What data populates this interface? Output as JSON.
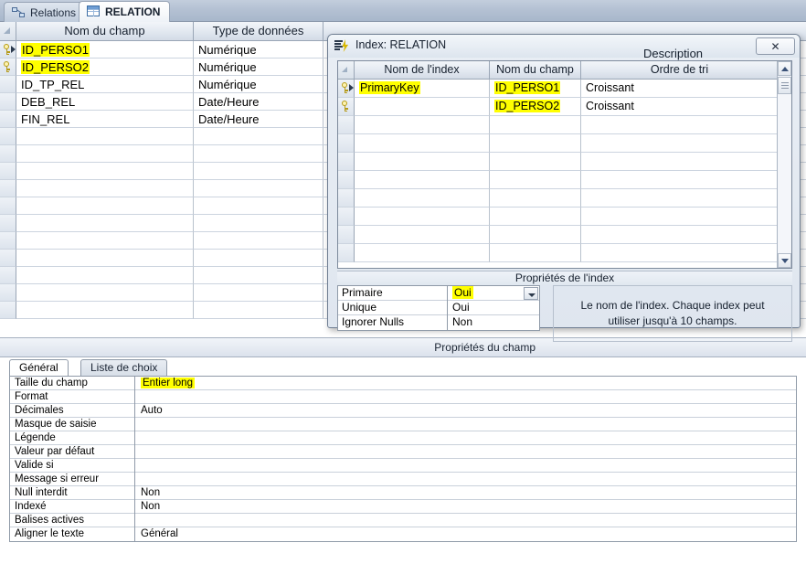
{
  "tabs": [
    {
      "label": "Relations",
      "icon": "relations-icon",
      "active": false
    },
    {
      "label": "RELATION",
      "icon": "table-icon",
      "active": true
    }
  ],
  "designer": {
    "columns": [
      "Nom du champ",
      "Type de données",
      "Description"
    ],
    "rows": [
      {
        "name": "ID_PERSO1",
        "type": "Numérique",
        "description": "",
        "key": true,
        "selected": true,
        "highlight": true
      },
      {
        "name": "ID_PERSO2",
        "type": "Numérique",
        "description": "",
        "key": true,
        "selected": false,
        "highlight": true
      },
      {
        "name": "ID_TP_REL",
        "type": "Numérique",
        "description": "",
        "key": false,
        "selected": false,
        "highlight": false
      },
      {
        "name": "DEB_REL",
        "type": "Date/Heure",
        "description": "",
        "key": false,
        "selected": false,
        "highlight": false
      },
      {
        "name": "FIN_REL",
        "type": "Date/Heure",
        "description": "",
        "key": false,
        "selected": false,
        "highlight": false
      }
    ],
    "empty_row_count": 11
  },
  "divider": {
    "label": "Propriétés du champ"
  },
  "field_properties": {
    "tabs": [
      {
        "label": "Général",
        "selected": true
      },
      {
        "label": "Liste de choix",
        "selected": false
      }
    ],
    "rows": [
      {
        "key": "Taille du champ",
        "value": "Entier long",
        "highlight": true
      },
      {
        "key": "Format",
        "value": "",
        "highlight": false
      },
      {
        "key": "Décimales",
        "value": "Auto",
        "highlight": false
      },
      {
        "key": "Masque de saisie",
        "value": "",
        "highlight": false
      },
      {
        "key": "Légende",
        "value": "",
        "highlight": false
      },
      {
        "key": "Valeur par défaut",
        "value": "",
        "highlight": false
      },
      {
        "key": "Valide si",
        "value": "",
        "highlight": false
      },
      {
        "key": "Message si erreur",
        "value": "",
        "highlight": false
      },
      {
        "key": "Null interdit",
        "value": "Non",
        "highlight": false
      },
      {
        "key": "Indexé",
        "value": "Non",
        "highlight": false
      },
      {
        "key": "Balises actives",
        "value": "",
        "highlight": false
      },
      {
        "key": "Aligner le texte",
        "value": "Général",
        "highlight": false
      }
    ]
  },
  "index_dialog": {
    "title": "Index: RELATION",
    "icon": "index-icon",
    "close_label": "✕",
    "columns": [
      "Nom de l'index",
      "Nom du champ",
      "Ordre de tri"
    ],
    "rows": [
      {
        "index_name": "PrimaryKey",
        "field_name": "ID_PERSO1",
        "sort_order": "Croissant",
        "key": true,
        "selected": true,
        "hl_index": true,
        "hl_field": true
      },
      {
        "index_name": "",
        "field_name": "ID_PERSO2",
        "sort_order": "Croissant",
        "key": true,
        "selected": false,
        "hl_index": false,
        "hl_field": true
      }
    ],
    "empty_row_count": 8,
    "properties_header": "Propriétés de l'index",
    "properties": [
      {
        "key": "Primaire",
        "value": "Oui",
        "highlight": true,
        "dropdown": true
      },
      {
        "key": "Unique",
        "value": "Oui",
        "highlight": false,
        "dropdown": false
      },
      {
        "key": "Ignorer Nulls",
        "value": "Non",
        "highlight": false,
        "dropdown": false
      }
    ],
    "hint": "Le nom de l'index. Chaque index peut utiliser jusqu'à 10 champs."
  },
  "background": {
    "description_header": "Description"
  },
  "colors": {
    "highlight": "#ffff00",
    "header_band": "#e3e9f1",
    "tab_strip": "#b4c1d3",
    "grid_line": "#ccd4df"
  }
}
